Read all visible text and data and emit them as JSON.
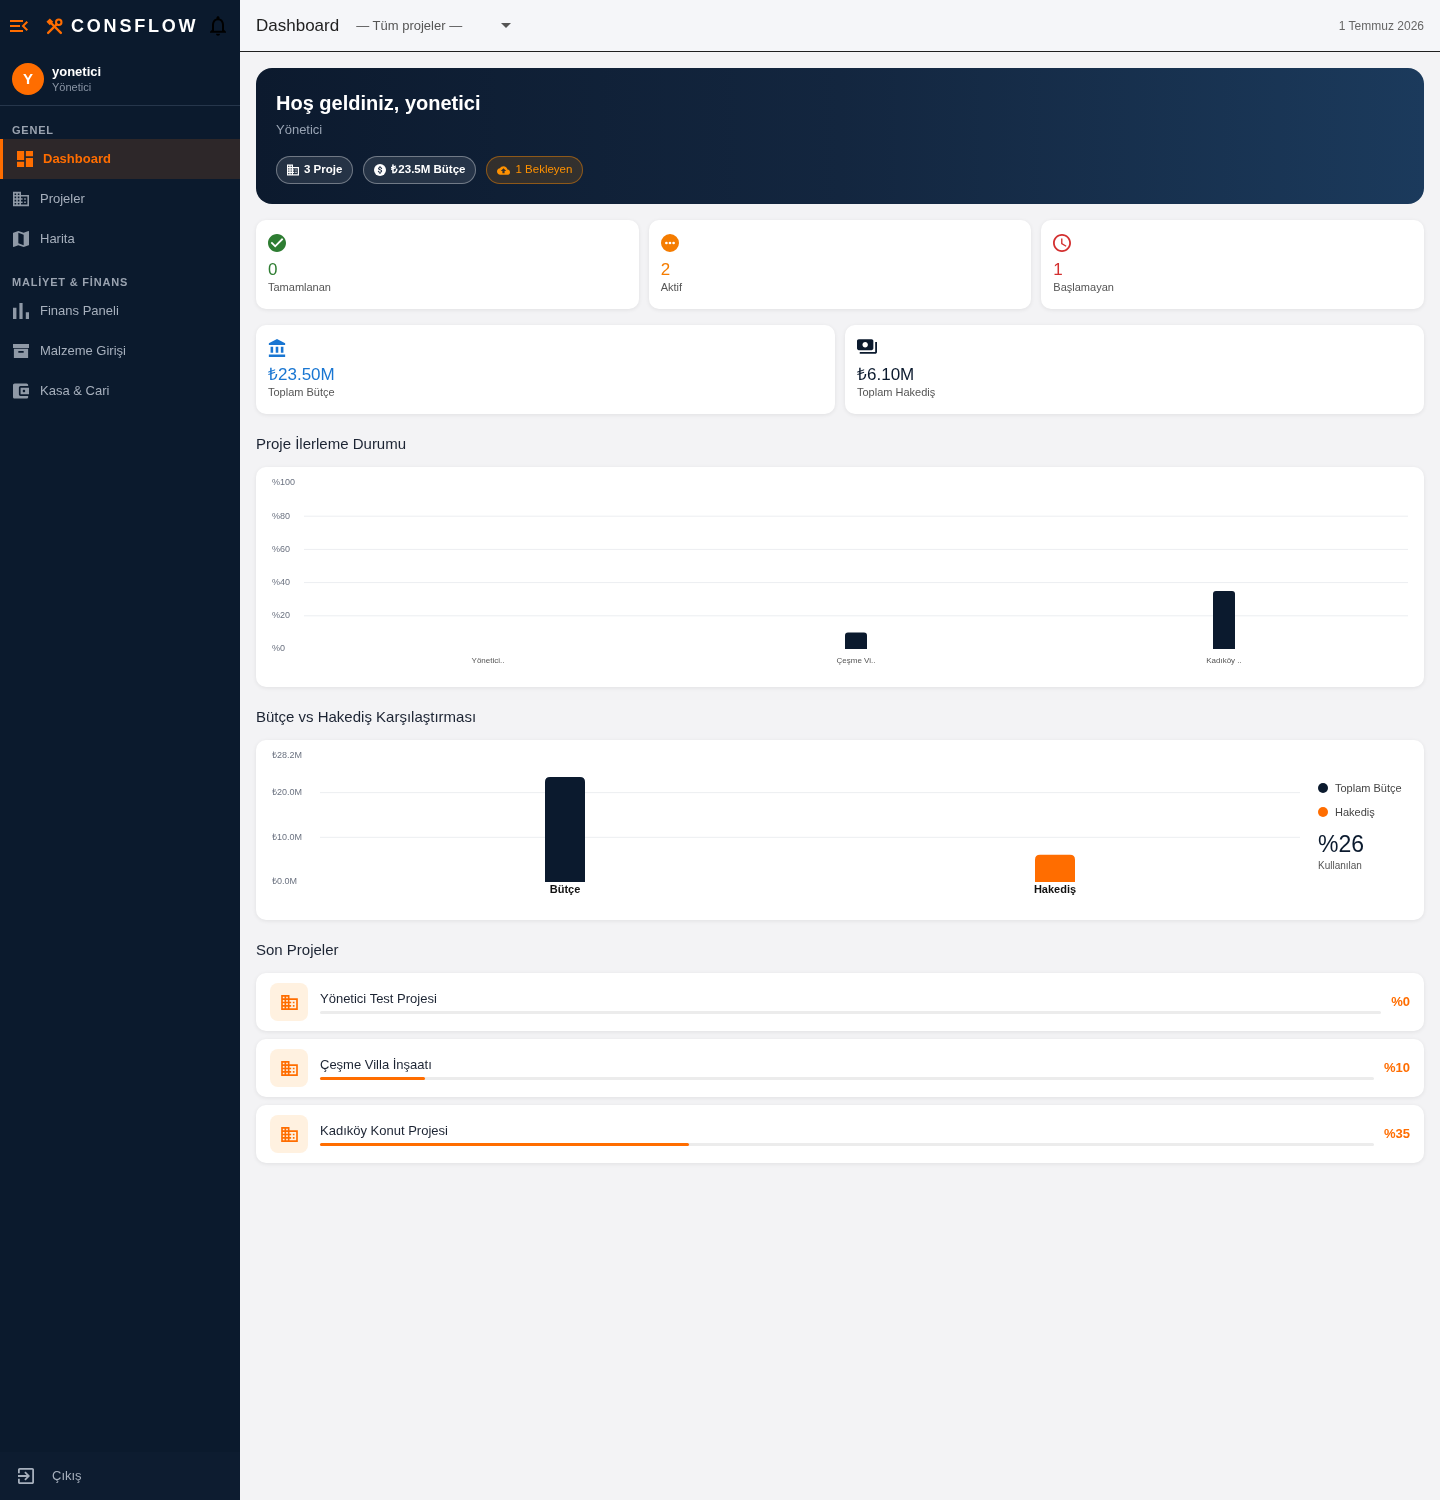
{
  "sidebar": {
    "brand": "CONSFLOW",
    "user": {
      "initial": "Y",
      "name": "yonetici",
      "role": "Yönetici"
    },
    "sections": [
      {
        "title": "GENEL",
        "items": [
          {
            "label": "Dashboard",
            "selected": true
          },
          {
            "label": "Projeler",
            "selected": false
          },
          {
            "label": "Harita",
            "selected": false
          }
        ]
      },
      {
        "title": "MALİYET & FİNANS",
        "items": [
          {
            "label": "Finans Paneli",
            "selected": false
          },
          {
            "label": "Malzeme Girişi",
            "selected": false
          },
          {
            "label": "Kasa & Cari",
            "selected": false
          }
        ]
      }
    ],
    "logout": "Çıkış"
  },
  "header": {
    "title": "Dashboard",
    "project_filter": "— Tüm projeler —",
    "date": "1 Temmuz 2026"
  },
  "hero": {
    "title": "Hoş geldiniz, yonetici",
    "subtitle": "Yönetici",
    "chips": [
      {
        "kind": "neutral",
        "label": "3 Proje"
      },
      {
        "kind": "neutral",
        "label": "₺23.5M Bütçe"
      },
      {
        "kind": "warning",
        "label": "1 Bekleyen"
      }
    ]
  },
  "status_cards": [
    {
      "value": "0",
      "label": "Tamamlanan",
      "color": "#2e7d32"
    },
    {
      "value": "2",
      "label": "Aktif",
      "color": "#f57c00"
    },
    {
      "value": "1",
      "label": "Başlamayan",
      "color": "#d32f2f"
    }
  ],
  "finance_cards": [
    {
      "value": "₺23.50M",
      "label": "Toplam Bütçe",
      "color": "#1976d2"
    },
    {
      "value": "₺6.10M",
      "label": "Toplam Hakediş",
      "color": "#0b1a2e"
    }
  ],
  "progress_section": {
    "title": "Proje İlerleme Durumu",
    "chart_data": {
      "type": "bar",
      "categories": [
        "Yönetici..",
        "Çeşme Vi..",
        "Kadıköy .."
      ],
      "values": [
        0,
        10,
        35
      ],
      "ylim": [
        0,
        100
      ],
      "yticks": [
        {
          "value": 0,
          "label": "%0"
        },
        {
          "value": 20,
          "label": "%20"
        },
        {
          "value": 40,
          "label": "%40"
        },
        {
          "value": 60,
          "label": "%60"
        },
        {
          "value": 80,
          "label": "%80"
        },
        {
          "value": 100,
          "label": "%100"
        }
      ],
      "grid": true
    }
  },
  "budget_section": {
    "title": "Bütçe vs Hakediş Karşılaştırması",
    "chart_data": {
      "type": "bar",
      "categories": [
        "Bütçe",
        "Hakediş"
      ],
      "series": [
        {
          "name": "Toplam Bütçe",
          "color": "#0b1a2e",
          "values": [
            23.5,
            null
          ]
        },
        {
          "name": "Hakediş",
          "color": "#ff6d00",
          "values": [
            null,
            6.1
          ]
        }
      ],
      "ylim": [
        0,
        28.2
      ],
      "yticks": [
        {
          "value": 0,
          "label": "₺0.0M"
        },
        {
          "value": 10,
          "label": "₺10.0M"
        },
        {
          "value": 20,
          "label": "₺20.0M"
        },
        {
          "value": 28.2,
          "label": "₺28.2M"
        }
      ],
      "grid": true
    },
    "usage": {
      "value": "%26",
      "label": "Kullanılan"
    }
  },
  "recent_projects": {
    "title": "Son Projeler",
    "items": [
      {
        "name": "Yönetici Test Projesi",
        "level": 0,
        "percent": "%0"
      },
      {
        "name": "Çeşme Villa İnşaatı",
        "level": 0.1,
        "percent": "%10"
      },
      {
        "name": "Kadıköy Konut Projesi",
        "level": 0.35,
        "percent": "%35"
      }
    ]
  }
}
